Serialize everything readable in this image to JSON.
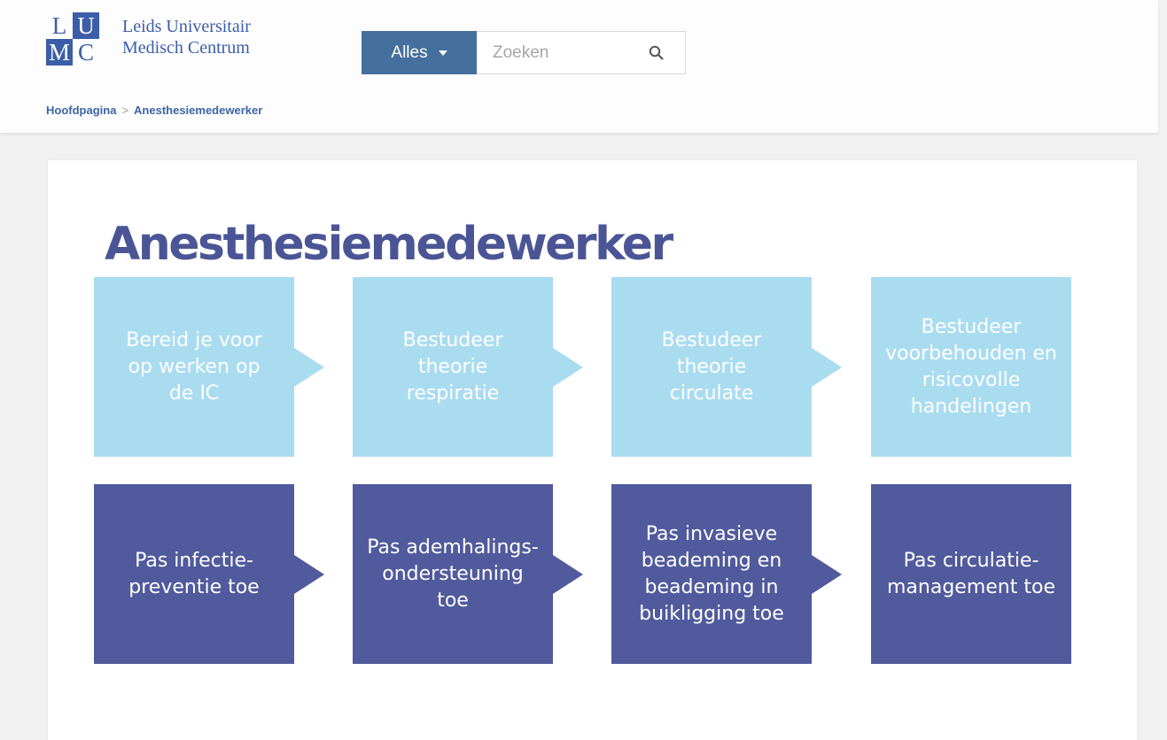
{
  "logo": {
    "letters": [
      "L",
      "U",
      "M",
      "C"
    ],
    "line1": "Leids Universitair",
    "line2": "Medisch Centrum"
  },
  "search": {
    "scope_label": "Alles",
    "placeholder": "Zoeken"
  },
  "breadcrumb": {
    "home": "Hoofdpagina",
    "separator": ">",
    "current": "Anesthesiemedewerker"
  },
  "page_title": "Anesthesiemedewerker",
  "steps_row1": [
    "Bereid je voor op werken op de IC",
    "Bestudeer theorie respiratie",
    "Bestudeer theorie circulate",
    "Bestudeer voorbehouden en risicovolle handelingen"
  ],
  "steps_row2": [
    "Pas infectie-preventie toe",
    "Pas ademhalings-ondersteuning toe",
    "Pas invasieve beademing en beademing in buikligging toe",
    "Pas circulatie-management toe"
  ],
  "colors": {
    "brand_blue": "#3c5ea8",
    "search_button": "#456f9c",
    "light_step": "#aadcf0",
    "dark_step": "#515a9c",
    "title": "#4b5596"
  }
}
